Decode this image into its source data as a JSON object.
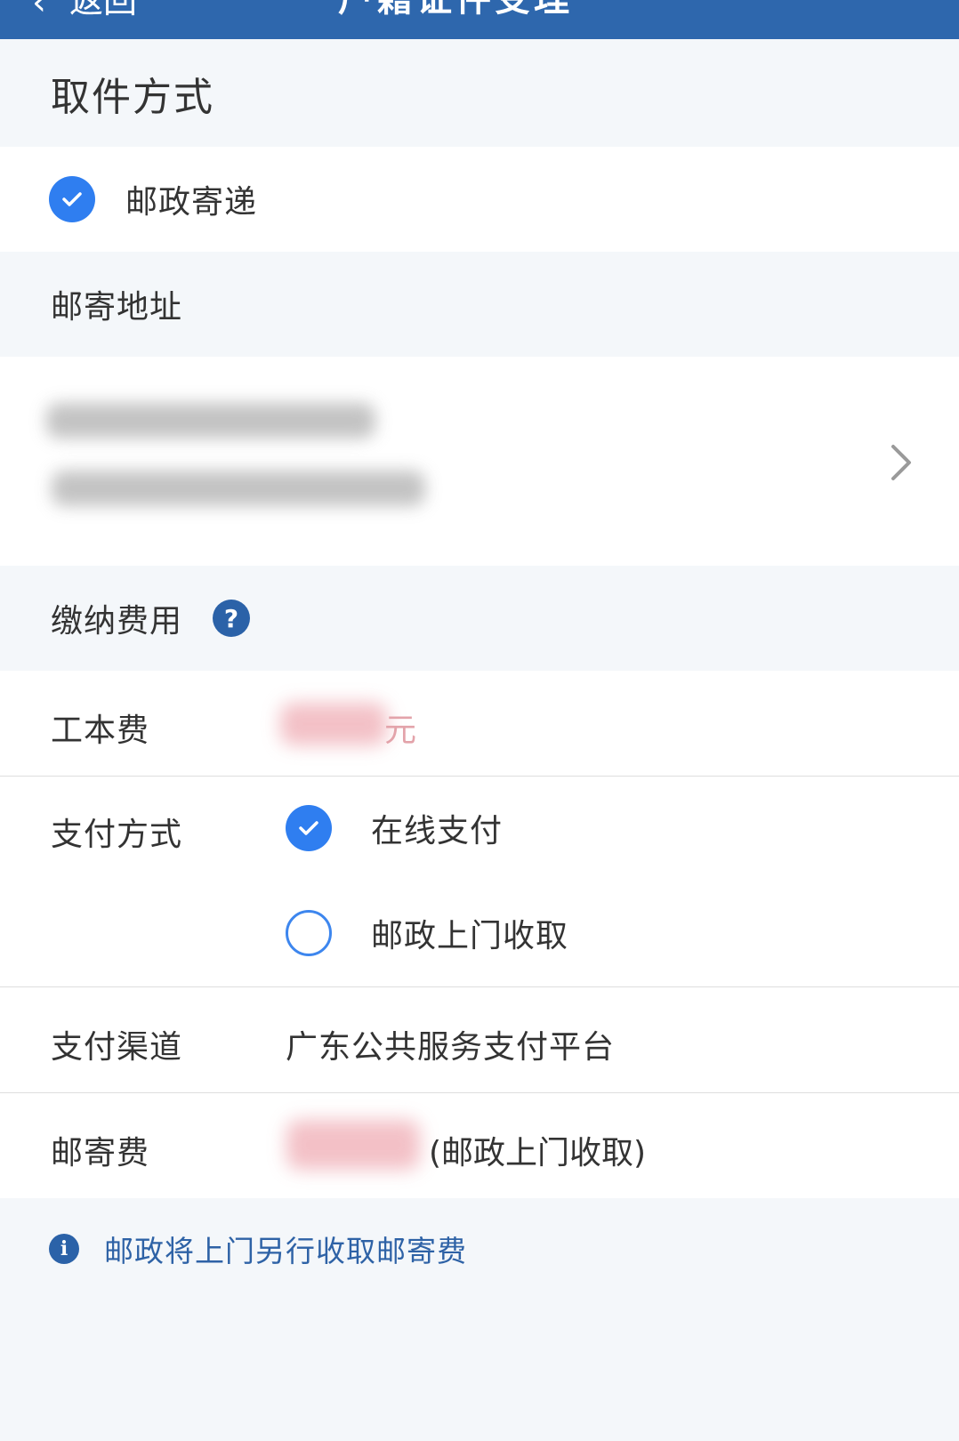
{
  "navbar": {
    "back_label": "返回",
    "title": "户籍证件受理"
  },
  "pickup": {
    "header": "取件方式",
    "option": "邮政寄递",
    "selected": true
  },
  "address": {
    "header": "邮寄地址"
  },
  "fee": {
    "header": "缴纳费用",
    "help_glyph": "?"
  },
  "cost": {
    "label": "工本费",
    "unit": "元"
  },
  "payment": {
    "label": "支付方式",
    "options": [
      {
        "label": "在线支付",
        "selected": true
      },
      {
        "label": "邮政上门收取",
        "selected": false
      }
    ]
  },
  "channel": {
    "label": "支付渠道",
    "value": "广东公共服务支付平台"
  },
  "postage": {
    "label": "邮寄费",
    "suffix": "(邮政上门收取)"
  },
  "notice": {
    "info_glyph": "i",
    "text": "邮政将上门另行收取邮寄费"
  },
  "colors": {
    "nav": "#2e67ad",
    "accent": "#2f7ef0",
    "notice_text": "#2e62a6"
  }
}
